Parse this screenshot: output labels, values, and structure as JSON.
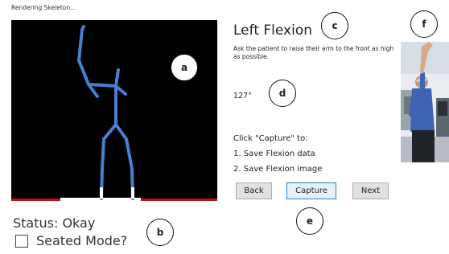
{
  "header": {
    "rendering_label": "Rendering Skeleton..."
  },
  "status": {
    "text": "Status:  Okay"
  },
  "seated_mode": {
    "label": "Seated Mode?",
    "checked": false
  },
  "exercise": {
    "title": "Left Flexion",
    "instruction": "Ask the patient to raise their arm to the front as high as possible.",
    "angle": "127°"
  },
  "capture_info": {
    "heading": "Click \"Capture\" to:",
    "step1": "1. Save Flexion data",
    "step2": "2. Save Flexion image"
  },
  "buttons": {
    "back": "Back",
    "capture": "Capture",
    "next": "Next"
  },
  "markers": {
    "a": "a",
    "b": "b",
    "c": "c",
    "d": "d",
    "e": "e",
    "f": "f"
  },
  "colors": {
    "skeleton_bone": "#4a7ed0",
    "floor": "#c0111a",
    "primary_border": "#2b7fd9"
  },
  "icons": {
    "skeleton_view": "skeleton-figure",
    "patient_photo": "patient-raising-arm-photo"
  }
}
